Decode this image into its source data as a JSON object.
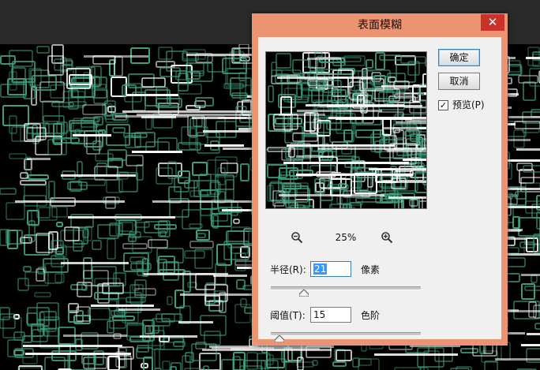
{
  "dialog": {
    "title": "表面模糊",
    "close_symbol": "✕",
    "ok_label": "确定",
    "cancel_label": "取消",
    "preview_checkbox": {
      "label": "预览(P)",
      "checked": true,
      "mark": "✓"
    },
    "zoom": {
      "level": "25%",
      "zoom_out_icon": "zoom-out-icon",
      "zoom_in_icon": "zoom-in-icon"
    },
    "radius": {
      "label": "半径(R):",
      "value": "21",
      "unit": "像素",
      "slider_fraction": 0.22
    },
    "threshold": {
      "label": "阈值(T):",
      "value": "15",
      "unit": "色阶",
      "slider_fraction": 0.06
    }
  },
  "colors": {
    "dialog_frame": "#ec9472",
    "close_button": "#c9312b",
    "canvas_glow": "#3fa27e",
    "canvas_highlight": "#ffffff",
    "app_background": "#2a2a2a"
  }
}
